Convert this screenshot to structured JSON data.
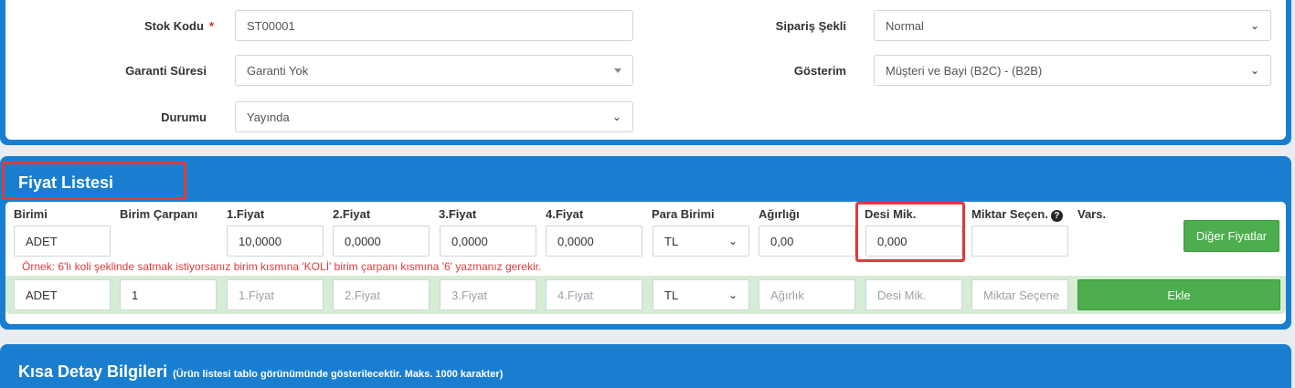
{
  "form": {
    "stock_code": {
      "label": "Stok Kodu",
      "required_mark": "*",
      "value": "ST00001"
    },
    "warranty": {
      "label": "Garanti Süresi",
      "value": "Garanti Yok"
    },
    "status": {
      "label": "Durumu",
      "value": "Yayında"
    },
    "order_type": {
      "label": "Sipariş Şekli",
      "value": "Normal"
    },
    "display": {
      "label": "Gösterim",
      "value": "Müşteri ve Bayi (B2C) - (B2B)"
    }
  },
  "price_list": {
    "title": "Fiyat Listesi",
    "columns": {
      "unit": "Birimi",
      "multiplier": "Birim Çarpanı",
      "price1": "1.Fiyat",
      "price2": "2.Fiyat",
      "price3": "3.Fiyat",
      "price4": "4.Fiyat",
      "currency": "Para Birimi",
      "weight": "Ağırlığı",
      "desi": "Desi Mik.",
      "qty_select": "Miktar Seçen.",
      "variants": "Vars."
    },
    "row": {
      "unit": "ADET",
      "price1": "10,0000",
      "price2": "0,0000",
      "price3": "0,0000",
      "price4": "0,0000",
      "currency": "TL",
      "weight": "0,00",
      "desi": "0,000",
      "qty_select": ""
    },
    "other_prices_button": "Diğer Fiyatlar",
    "hint": "Örnek: 6'lı koli şeklinde satmak istiyorsanız birim kısmına 'KOLİ' birim çarpanı kısmına '6' yazmanız gerekir.",
    "new_row": {
      "unit": "ADET",
      "multiplier": "1",
      "price1_ph": "1.Fiyat",
      "price2_ph": "2.Fiyat",
      "price3_ph": "3.Fiyat",
      "price4_ph": "4.Fiyat",
      "currency": "TL",
      "weight_ph": "Ağırlık",
      "desi_ph": "Desi Mik.",
      "qty_ph": "Miktar Seçene"
    },
    "add_button": "Ekle"
  },
  "detail": {
    "title": "Kısa Detay Bilgileri",
    "subtitle": "(Ürün listesi tablo görünümünde gösterilecektir. Maks. 1000 karakter)"
  },
  "icons": {
    "chevron": "chevron-down-icon",
    "caret": "caret-down-icon",
    "help": "question-circle-icon"
  },
  "colors": {
    "panel_blue": "#1a7ed0",
    "highlight_red": "#e03a3a",
    "button_green": "#4cae4c",
    "add_row_green": "#d4edd4"
  }
}
